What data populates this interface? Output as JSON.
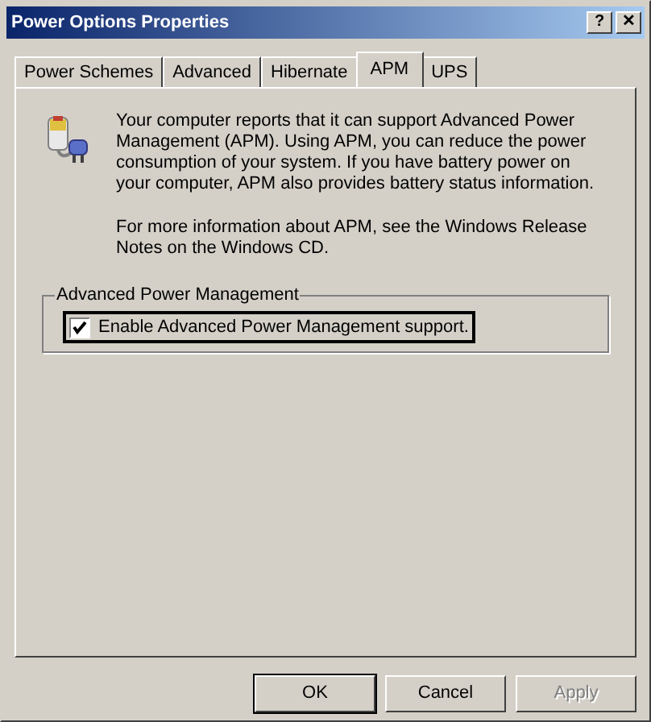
{
  "window": {
    "title": "Power Options Properties",
    "title_buttons": [
      "?",
      "✕"
    ]
  },
  "tabs": [
    {
      "label": "Power Schemes",
      "selected": false
    },
    {
      "label": "Advanced",
      "selected": false
    },
    {
      "label": "Hibernate",
      "selected": false
    },
    {
      "label": "APM",
      "selected": true
    },
    {
      "label": "UPS",
      "selected": false
    }
  ],
  "description": [
    "Your computer reports that it can support Advanced Power Management (APM).  Using APM, you can reduce the power consumption of your system.  If you have battery power on your computer, APM also provides battery status information.",
    "For more information about APM, see the Windows Release Notes on the Windows CD."
  ],
  "group": {
    "title": "Advanced Power Management",
    "checkbox": {
      "label": "Enable Advanced Power Management support.",
      "checked": true,
      "focused": true
    }
  },
  "buttons": [
    {
      "label": "OK",
      "default": true,
      "disabled": false
    },
    {
      "label": "Cancel",
      "default": false,
      "disabled": false
    },
    {
      "label": "Apply",
      "default": false,
      "disabled": true
    }
  ]
}
